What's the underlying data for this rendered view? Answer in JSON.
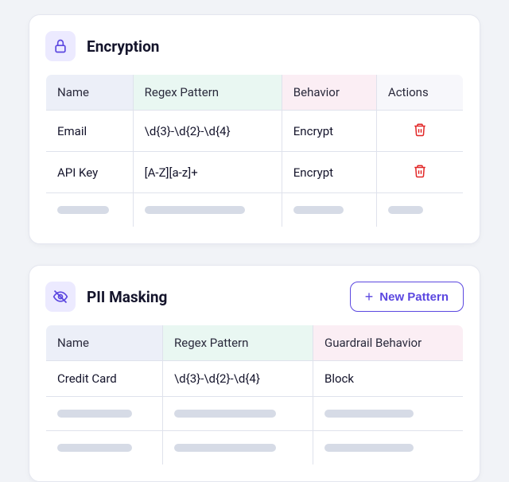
{
  "sections": {
    "encryption": {
      "title": "Encryption",
      "columns": {
        "name": "Name",
        "regex": "Regex Pattern",
        "behavior": "Behavior",
        "actions": "Actions"
      },
      "rows": [
        {
          "name": "Email",
          "regex": "\\d{3}-\\d{2}-\\d{4}",
          "behavior": "Encrypt"
        },
        {
          "name": "API Key",
          "regex": "[A-Z][a-z]+",
          "behavior": "Encrypt"
        }
      ]
    },
    "pii": {
      "title": "PII Masking",
      "new_button_label": "New Pattern",
      "columns": {
        "name": "Name",
        "regex": "Regex Pattern",
        "behavior": "Guardrail Behavior"
      },
      "rows": [
        {
          "name": "Credit Card",
          "regex": "\\d{3}-\\d{2}-\\d{4}",
          "behavior": "Block"
        }
      ]
    }
  }
}
